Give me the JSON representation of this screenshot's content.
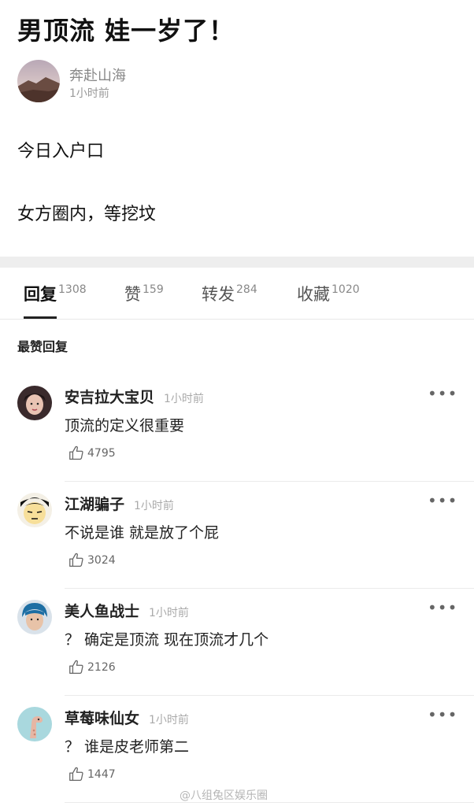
{
  "post": {
    "title": "男顶流 娃一岁了！",
    "author": {
      "name": "奔赴山海",
      "time": "1小时前"
    },
    "body_lines": [
      "今日入户口",
      "女方圈内，等挖坟"
    ]
  },
  "tabs": [
    {
      "label": "回复",
      "count": "1308",
      "active": true
    },
    {
      "label": "赞",
      "count": "159",
      "active": false
    },
    {
      "label": "转发",
      "count": "284",
      "active": false
    },
    {
      "label": "收藏",
      "count": "1020",
      "active": false
    }
  ],
  "section_heading": "最赞回复",
  "comments": [
    {
      "name": "安吉拉大宝贝",
      "time": "1小时前",
      "text": "顶流的定义很重要",
      "likes": "4795",
      "more": "•••"
    },
    {
      "name": "江湖骗子",
      "time": "1小时前",
      "text": "不说是谁 就是放了个屁",
      "likes": "3024",
      "more": "•••"
    },
    {
      "name": "美人鱼战士",
      "time": "1小时前",
      "text": "？ 确定是顶流 现在顶流才几个",
      "likes": "2126",
      "more": "•••"
    },
    {
      "name": "草莓味仙女",
      "time": "1小时前",
      "text": "？ 谁是皮老师第二",
      "likes": "1447",
      "more": "•••"
    }
  ],
  "watermark": "@八组兔区娱乐圈",
  "icons": {
    "like": "thumbs-up-icon",
    "more": "more-dots-icon"
  }
}
